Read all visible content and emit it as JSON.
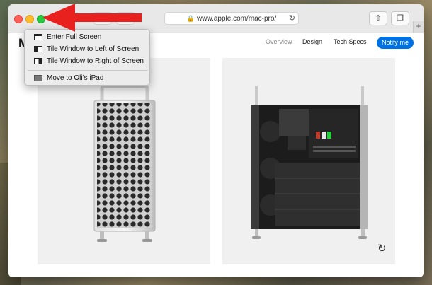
{
  "browser": {
    "url": "www.apple.com/mac-pro/",
    "lock_icon": "lock-icon",
    "reload_icon": "reload-icon",
    "share_icon": "share-icon",
    "tabs_icon": "tabs-overview-icon",
    "new_tab_label": "+"
  },
  "page": {
    "brand_partial": "M",
    "nav": [
      "Overview",
      "Design",
      "Tech Specs"
    ],
    "notify_label": "Notify me",
    "replay_icon": "replay-icon"
  },
  "menu": {
    "items": [
      {
        "label": "Enter Full Screen",
        "icon": "fullscreen-icon"
      },
      {
        "label": "Tile Window to Left of Screen",
        "icon": "tile-left-icon"
      },
      {
        "label": "Tile Window to Right of Screen",
        "icon": "tile-right-icon"
      },
      {
        "label": "Move to Oli’s iPad",
        "icon": "ipad-icon"
      }
    ]
  },
  "annotation": {
    "arrow_color": "#e8201e"
  }
}
